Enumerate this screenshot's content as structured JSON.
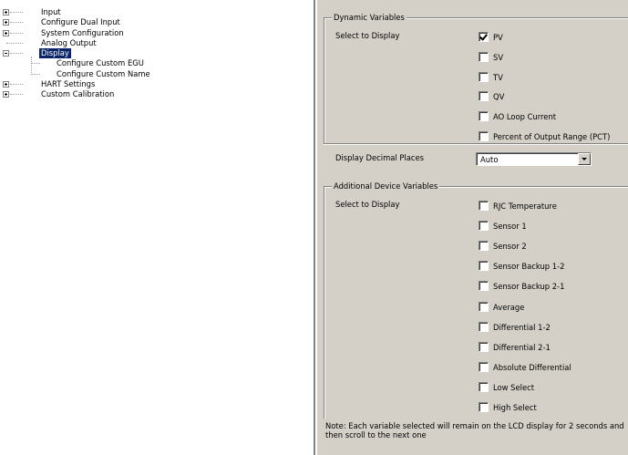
{
  "tree": {
    "items": [
      {
        "label": "Input",
        "expander": "plus"
      },
      {
        "label": "Configure Dual Input",
        "expander": "plus"
      },
      {
        "label": "System Configuration",
        "expander": "plus"
      },
      {
        "label": "Analog Output",
        "expander": "none"
      },
      {
        "label": "Display",
        "expander": "minus",
        "selected": true
      },
      {
        "label": "Configure Custom EGU",
        "expander": "child"
      },
      {
        "label": "Configure Custom Name",
        "expander": "child"
      },
      {
        "label": "HART Settings",
        "expander": "plus"
      },
      {
        "label": "Custom Calibration",
        "expander": "plus"
      }
    ]
  },
  "dynamic_variables": {
    "title": "Dynamic Variables",
    "select_label": "Select to Display",
    "options": [
      {
        "label": "PV",
        "checked": true
      },
      {
        "label": "SV",
        "checked": false
      },
      {
        "label": "TV",
        "checked": false
      },
      {
        "label": "QV",
        "checked": false
      },
      {
        "label": "AO Loop Current",
        "checked": false
      },
      {
        "label": "Percent of Output Range (PCT)",
        "checked": false
      }
    ]
  },
  "decimal_places": {
    "label": "Display Decimal Places",
    "value": "Auto"
  },
  "additional_variables": {
    "title": "Additional Device Variables",
    "select_label": "Select to Display",
    "options": [
      {
        "label": "RJC Temperature",
        "checked": false
      },
      {
        "label": "Sensor 1",
        "checked": false
      },
      {
        "label": "Sensor 2",
        "checked": false
      },
      {
        "label": "Sensor Backup 1-2",
        "checked": false
      },
      {
        "label": "Sensor Backup 2-1",
        "checked": false
      },
      {
        "label": "Average",
        "checked": false
      },
      {
        "label": "Differential 1-2",
        "checked": false
      },
      {
        "label": "Differential 2-1",
        "checked": false
      },
      {
        "label": "Absolute Differential",
        "checked": false
      },
      {
        "label": "Low Select",
        "checked": false
      },
      {
        "label": "High Select",
        "checked": false
      }
    ]
  },
  "note": "Note: Each variable selected will remain on the LCD display for 2 seconds and then scroll to the next one"
}
